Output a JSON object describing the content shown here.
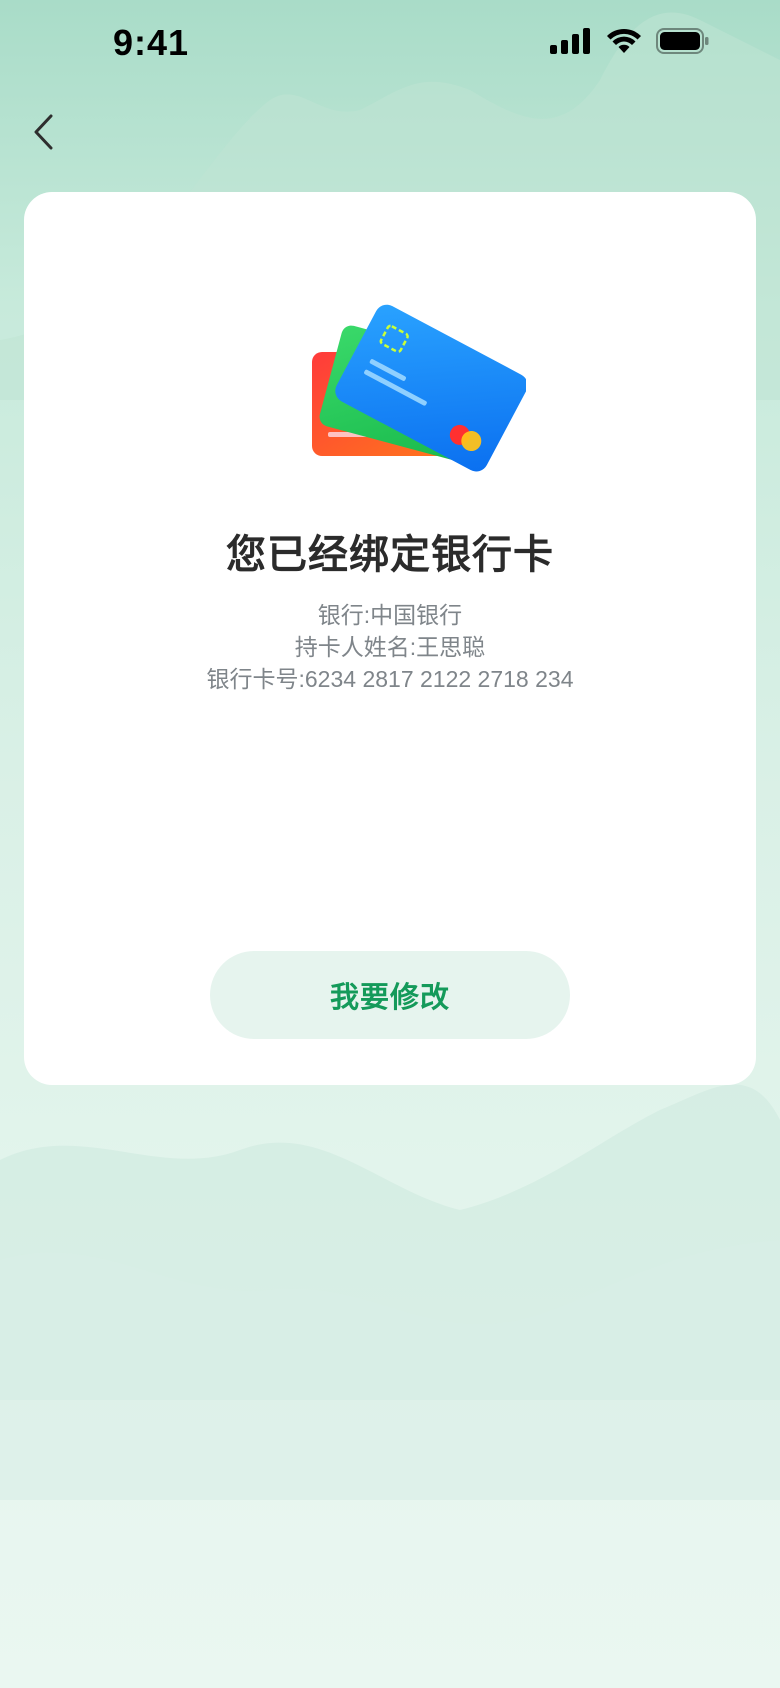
{
  "status_bar": {
    "time": "9:41"
  },
  "nav": {
    "back_icon": "chevron-left-icon"
  },
  "card": {
    "illustration": "bank-cards-icon",
    "title": "您已经绑定银行卡",
    "bank_line": "银行:中国银行",
    "holder_line": "持卡人姓名:王思聪",
    "card_number_line": "银行卡号:6234 2817 2122 2718 234",
    "edit_button": "我要修改"
  },
  "colors": {
    "accent": "#149a5a",
    "button_bg": "#e6f4ee",
    "title": "#2b2b2b",
    "secondary_text": "#7f858a"
  }
}
